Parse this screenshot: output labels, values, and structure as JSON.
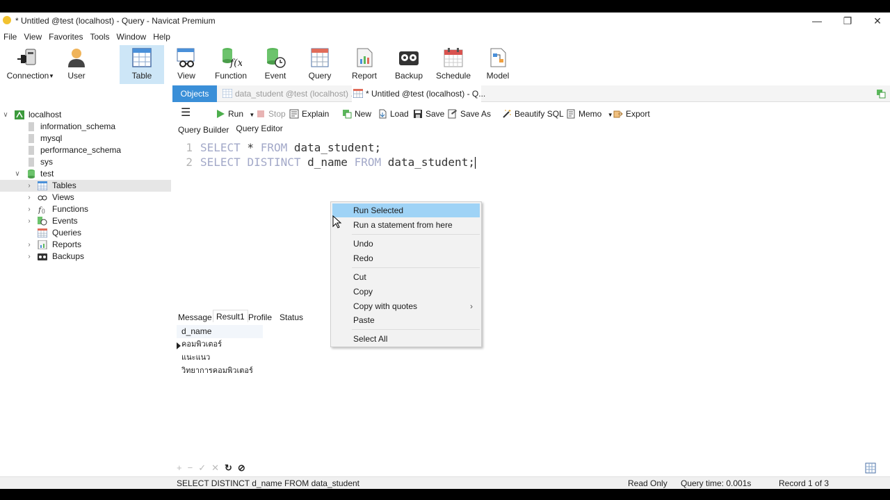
{
  "window": {
    "title": "* Untitled @test (localhost) - Query - Navicat Premium",
    "controls": [
      "minimize",
      "restore",
      "close"
    ]
  },
  "menu": [
    "File",
    "View",
    "Favorites",
    "Tools",
    "Window",
    "Help"
  ],
  "ribbon": [
    {
      "label": "Connection",
      "icon": "connection-icon"
    },
    {
      "label": "User",
      "icon": "user-icon"
    },
    {
      "label": "Table",
      "icon": "table-icon",
      "active": true
    },
    {
      "label": "View",
      "icon": "view-icon"
    },
    {
      "label": "Function",
      "icon": "function-icon"
    },
    {
      "label": "Event",
      "icon": "event-icon"
    },
    {
      "label": "Query",
      "icon": "query-icon"
    },
    {
      "label": "Report",
      "icon": "report-icon"
    },
    {
      "label": "Backup",
      "icon": "backup-icon"
    },
    {
      "label": "Schedule",
      "icon": "schedule-icon"
    },
    {
      "label": "Model",
      "icon": "model-icon"
    }
  ],
  "tree": {
    "connection": "localhost",
    "databases": [
      "information_schema",
      "mysql",
      "performance_schema",
      "sys",
      "test"
    ],
    "test_children": [
      "Tables",
      "Views",
      "Functions",
      "Events",
      "Queries",
      "Reports",
      "Backups"
    ],
    "selected": "Tables"
  },
  "tabs": {
    "objects": "Objects",
    "tab1": "data_student @test (localhost) ...",
    "tab2": "* Untitled @test (localhost) - Q..."
  },
  "editor_toolbar": {
    "run": "Run",
    "stop": "Stop",
    "explain": "Explain",
    "new": "New",
    "load": "Load",
    "save": "Save",
    "save_as": "Save As",
    "beautify": "Beautify SQL",
    "memo": "Memo",
    "export": "Export"
  },
  "subtabs": {
    "builder": "Query Builder",
    "editor": "Query Editor"
  },
  "code": {
    "line1": {
      "num": "1",
      "k1": "SELECT",
      "t1": " * ",
      "k2": "FROM",
      "t2": " data_student;"
    },
    "line2": {
      "num": "2",
      "k1": "SELECT",
      "t1": " ",
      "k2": "DISTINCT",
      "t2": " d_name ",
      "k3": "FROM",
      "t3": " data_student;"
    }
  },
  "result_tabs": {
    "message": "Message",
    "result": "Result1",
    "profile": "Profile",
    "status": "Status"
  },
  "result": {
    "column": "d_name",
    "rows": [
      "คอมพิวเตอร์",
      "แนะแนว",
      "วิทยาการคอมพิวเตอร์"
    ]
  },
  "context_menu": {
    "run_selected": "Run Selected",
    "run_from_here": "Run a statement from here",
    "undo": "Undo",
    "redo": "Redo",
    "cut": "Cut",
    "copy": "Copy",
    "copy_quotes": "Copy with quotes",
    "paste": "Paste",
    "select_all": "Select All"
  },
  "status": {
    "sql": "SELECT DISTINCT d_name FROM data_student",
    "mode": "Read Only",
    "time": "Query time: 0.001s",
    "record": "Record 1 of 3"
  },
  "colors": {
    "accent": "#3a8fd8",
    "menu_highlight": "#9fd3f6",
    "keyword": "#a2a8c8"
  }
}
